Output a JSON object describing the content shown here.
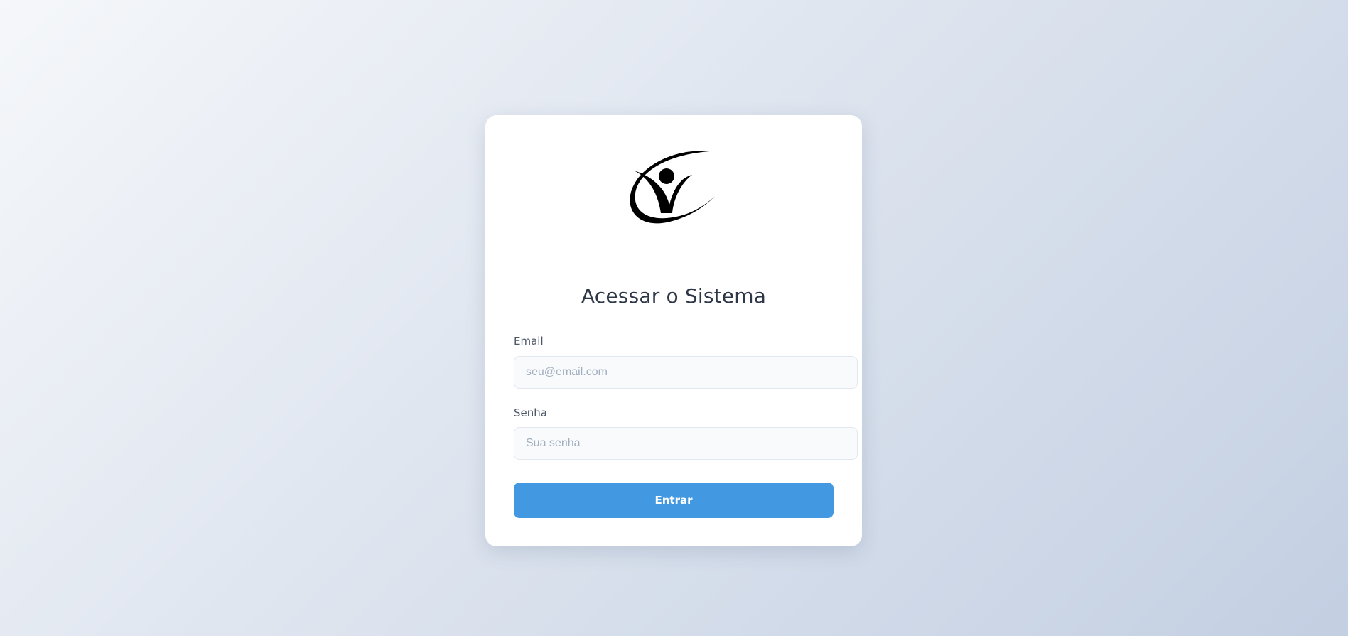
{
  "page": {
    "logo_icon": "person-swoosh-logo-icon",
    "title": "Acessar o Sistema"
  },
  "form": {
    "email": {
      "label": "Email",
      "value": "",
      "placeholder": "seu@email.com"
    },
    "senha": {
      "label": "Senha",
      "value": "",
      "placeholder": "Sua senha"
    },
    "submit_label": "Entrar"
  },
  "colors": {
    "background_start": "#f5f7fa",
    "background_end": "#c3cfe2",
    "card": "#ffffff",
    "title": "#2d3748",
    "label": "#4a5568",
    "input_bg": "#f8fafc",
    "input_border": "#e2e8f0",
    "placeholder": "#a0aec0",
    "button": "#4299e1",
    "button_text": "#ffffff"
  }
}
